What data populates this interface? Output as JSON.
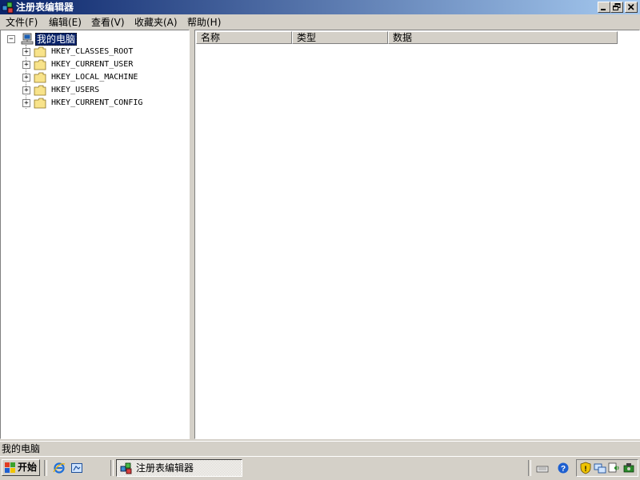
{
  "window": {
    "title": "注册表编辑器"
  },
  "menu": {
    "items": [
      {
        "label": "文件(F)"
      },
      {
        "label": "编辑(E)"
      },
      {
        "label": "查看(V)"
      },
      {
        "label": "收藏夹(A)"
      },
      {
        "label": "帮助(H)"
      }
    ]
  },
  "tree": {
    "root": {
      "label": "我的电脑",
      "icon": "computer-icon",
      "expanded": true,
      "selected": true
    },
    "nodes": [
      {
        "label": "HKEY_CLASSES_ROOT",
        "icon": "folder-icon"
      },
      {
        "label": "HKEY_CURRENT_USER",
        "icon": "folder-icon"
      },
      {
        "label": "HKEY_LOCAL_MACHINE",
        "icon": "folder-icon"
      },
      {
        "label": "HKEY_USERS",
        "icon": "folder-icon"
      },
      {
        "label": "HKEY_CURRENT_CONFIG",
        "icon": "folder-icon"
      }
    ]
  },
  "list": {
    "columns": [
      {
        "label": "名称"
      },
      {
        "label": "类型"
      },
      {
        "label": "数据"
      }
    ]
  },
  "status": {
    "text": "我的电脑"
  },
  "taskbar": {
    "start_label": "开始",
    "task_label": "注册表编辑器"
  },
  "colors": {
    "titlebar_start": "#0a246a",
    "titlebar_end": "#a6caf0",
    "face": "#d4d0c8",
    "selection": "#0a246a"
  }
}
